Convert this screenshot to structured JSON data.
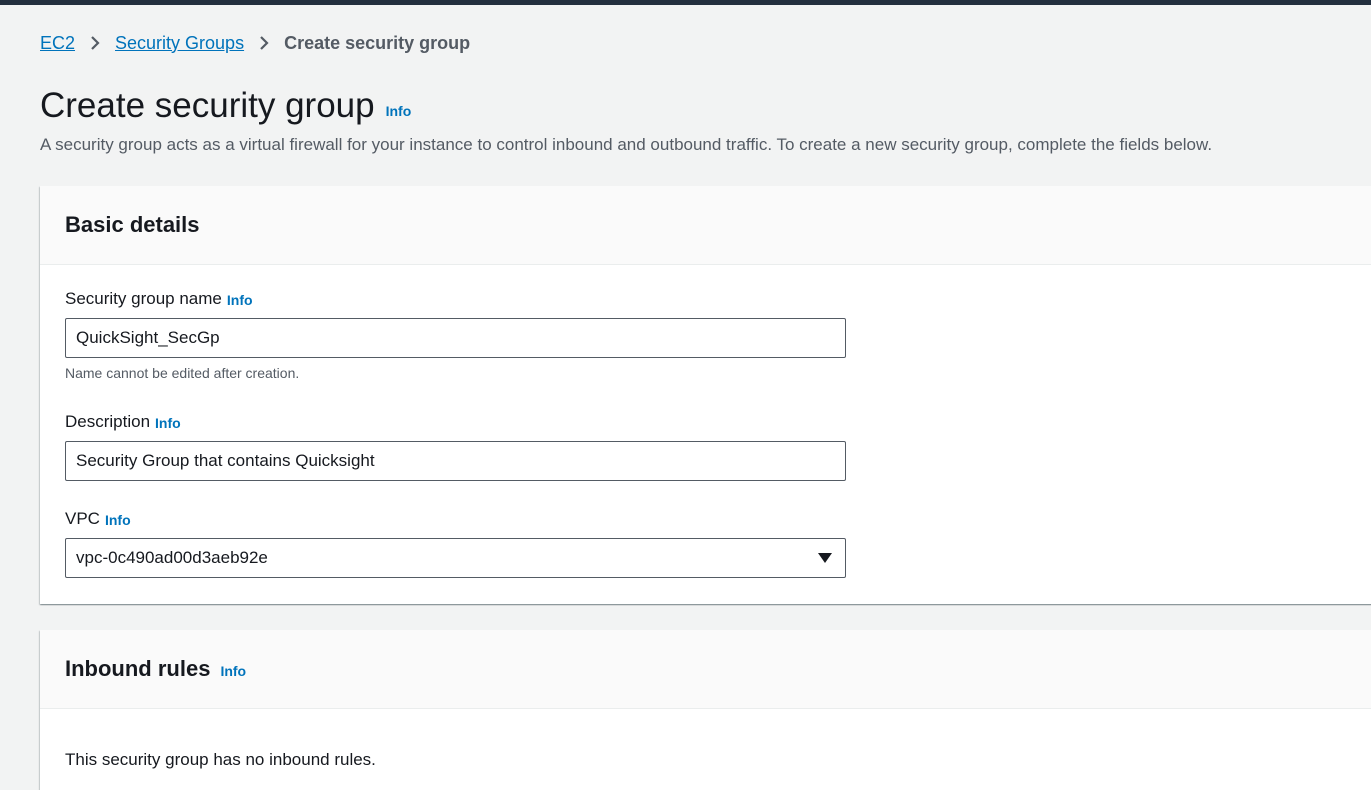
{
  "breadcrumb": {
    "items": [
      "EC2",
      "Security Groups"
    ],
    "current": "Create security group"
  },
  "page": {
    "title": "Create security group",
    "info_label": "Info",
    "description": "A security group acts as a virtual firewall for your instance to control inbound and outbound traffic. To create a new security group, complete the fields below."
  },
  "basic_details": {
    "title": "Basic details",
    "name_field": {
      "label": "Security group name",
      "info_label": "Info",
      "value": "QuickSight_SecGp",
      "constraint": "Name cannot be edited after creation."
    },
    "description_field": {
      "label": "Description",
      "info_label": "Info",
      "value": "Security Group that contains Quicksight"
    },
    "vpc_field": {
      "label": "VPC",
      "info_label": "Info",
      "selected": "vpc-0c490ad00d3aeb92e"
    }
  },
  "inbound_rules": {
    "title": "Inbound rules",
    "info_label": "Info",
    "empty_text": "This security group has no inbound rules."
  },
  "colors": {
    "link": "#0073bb",
    "page_background": "#f2f3f3",
    "header_strip": "#232f3e",
    "text_primary": "#16191f",
    "text_secondary": "#545b64"
  },
  "icons": {
    "breadcrumb_separator": "chevron-right-icon",
    "select_caret": "caret-down-icon"
  }
}
